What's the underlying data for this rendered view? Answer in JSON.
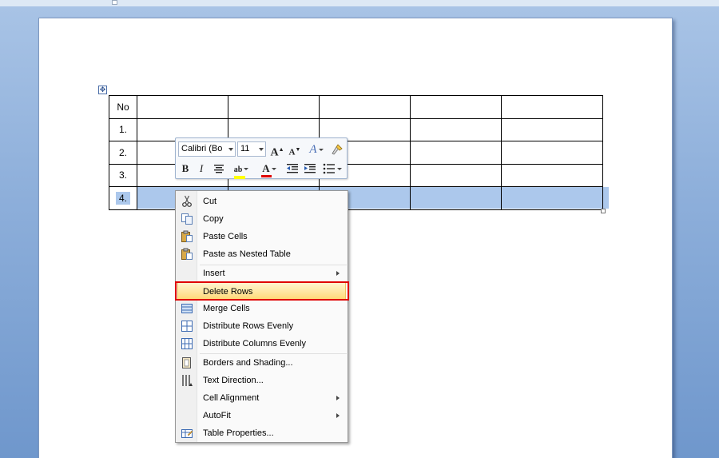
{
  "table": {
    "rows": [
      [
        "No",
        "",
        "",
        "",
        "",
        ""
      ],
      [
        "1.",
        "",
        "",
        "",
        "",
        ""
      ],
      [
        "2.",
        "",
        "",
        "",
        "",
        ""
      ],
      [
        "3.",
        "",
        "",
        "",
        "",
        ""
      ],
      [
        "4.",
        "",
        "",
        "",
        "",
        ""
      ]
    ],
    "selected_row_index": 4
  },
  "mini_toolbar": {
    "font_name": "Calibri (Bo",
    "font_size": "11",
    "bold_label": "B",
    "italic_label": "I",
    "font_color_label": "A",
    "highlight_label": "ab",
    "grow_font_label": "A",
    "shrink_font_label": "A",
    "styles_label": "A"
  },
  "context_menu": {
    "items": [
      {
        "label": "Cut",
        "icon": "scissors-icon"
      },
      {
        "label": "Copy",
        "icon": "copy-icon"
      },
      {
        "label": "Paste Cells",
        "icon": "paste-icon"
      },
      {
        "label": "Paste as Nested Table",
        "icon": "paste-icon"
      },
      {
        "label": "Insert",
        "icon": "",
        "submenu": true
      },
      {
        "label": "Delete Rows",
        "icon": "",
        "highlighted": true
      },
      {
        "label": "Merge Cells",
        "icon": "merge-cells-icon"
      },
      {
        "label": "Distribute Rows Evenly",
        "icon": "distribute-rows-icon"
      },
      {
        "label": "Distribute Columns Evenly",
        "icon": "distribute-columns-icon"
      },
      {
        "label": "Borders and Shading...",
        "icon": "borders-icon"
      },
      {
        "label": "Text Direction...",
        "icon": "text-direction-icon"
      },
      {
        "label": "Cell Alignment",
        "icon": "",
        "submenu": true
      },
      {
        "label": "AutoFit",
        "icon": "",
        "submenu": true
      },
      {
        "label": "Table Properties...",
        "icon": "table-properties-icon"
      }
    ]
  },
  "colors": {
    "selection": "#acc8ec",
    "menu_highlight": "#ffe8a6",
    "annotation_box": "#e00000",
    "font_color_bar": "#e00000",
    "highlight_bar": "#ffff00"
  }
}
